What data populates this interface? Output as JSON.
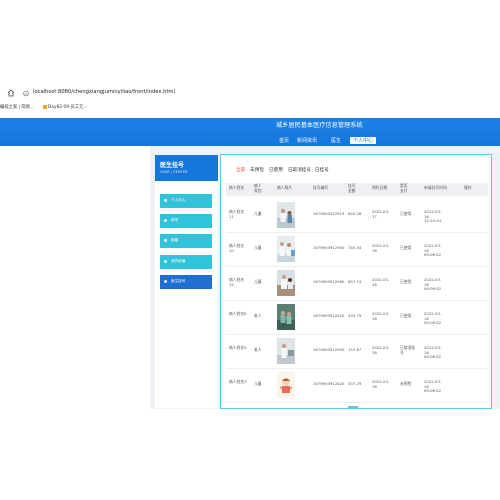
{
  "browser": {
    "url": "localhost:8080/chengxiangjuminyiliao/front/index.html",
    "bookmarks": [
      "编程之家 | 简易...",
      "Day82-09-员工元..."
    ]
  },
  "header": {
    "site_title": "城乡居民基本医疗信息管理系统",
    "nav": [
      "首页",
      "新闻资讯",
      "医生",
      "个人中心"
    ]
  },
  "sidebar": {
    "title": "医生挂号",
    "subtitle": "USER / CENTER",
    "items": [
      "个人中心",
      "修改",
      "收藏",
      "我的收藏",
      "医生挂号"
    ]
  },
  "filters": [
    "全部",
    "未预检",
    "已使用",
    "已取消挂号",
    "已挂号"
  ],
  "table": {
    "headers": [
      "病人姓名",
      "病人类别",
      "病人照片",
      "挂号编号",
      "挂号金额",
      "预约日期",
      "是否支付",
      "申请挂号时间",
      "操作"
    ],
    "rows": [
      {
        "name": "病人姓名11",
        "category": "儿童",
        "number": "1679904322913",
        "amount": "620.28",
        "date": "2022-03-17",
        "status": "已使用",
        "time": "2022-03-16 15:10:24"
      },
      {
        "name": "病人姓名10",
        "category": "儿童",
        "number": "1679903912950",
        "amount": "745.34",
        "date": "2022-03-16",
        "status": "已使用",
        "time": "2022-03-16 09:06:52"
      },
      {
        "name": "病人姓名12",
        "category": "儿童",
        "number": "1679903912960",
        "amount": "697.74",
        "date": "2022-03-16",
        "status": "已使用",
        "time": "2022-03-16 09:06:52"
      },
      {
        "name": "病人姓名8",
        "category": "老人",
        "number": "1679903912420",
        "amount": "435.79",
        "date": "2022-03-16",
        "status": "已使用",
        "time": "2022-03-16 09:06:52"
      },
      {
        "name": "病人姓名5",
        "category": "老人",
        "number": "1679903912590",
        "amount": "157.67",
        "date": "2022-03-16",
        "status": "已取消挂号",
        "time": "2022-03-16 09:06:52"
      },
      {
        "name": "病人姓名3",
        "category": "儿童",
        "number": "1679903912420",
        "amount": "337.29",
        "date": "2022-03-16",
        "status": "未预检",
        "time": "2022-03-16 09:06:52"
      }
    ]
  },
  "colors": {
    "brand": "#1676da",
    "accent": "#31c3d9",
    "active_filter": "#e64545"
  }
}
